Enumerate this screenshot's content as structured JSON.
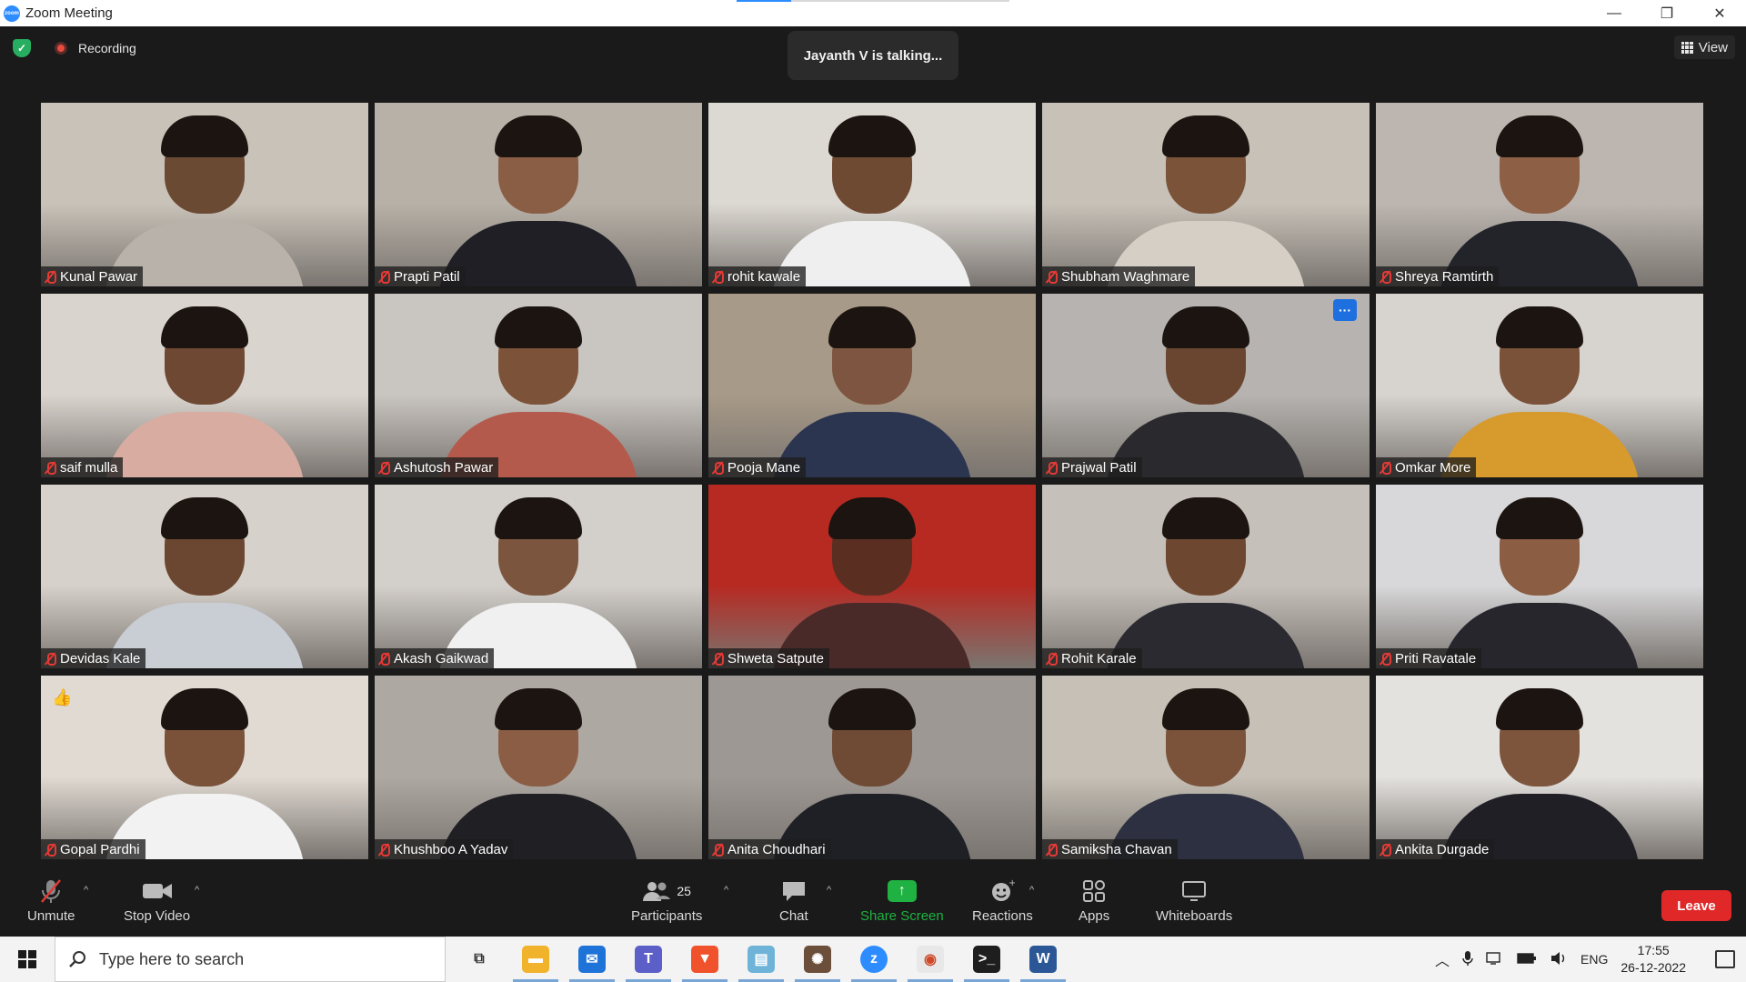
{
  "window": {
    "title": "Zoom Meeting",
    "minimize": "—",
    "restore": "❐",
    "close": "✕"
  },
  "meeting": {
    "recording_label": "Recording",
    "talking_banner": "Jayanth V is talking...",
    "view_label": "View"
  },
  "participants": [
    {
      "name": "Kunal Pawar",
      "bg": "#c9c2b9",
      "skin": "#6b4a34",
      "shirt": "#b9b2aa"
    },
    {
      "name": "Prapti Patil",
      "bg": "#b8b1a8",
      "skin": "#8a5e44",
      "shirt": "#1f1f25"
    },
    {
      "name": "rohit kawale",
      "bg": "#dcd8d2",
      "skin": "#6f4a33",
      "shirt": "#efefef"
    },
    {
      "name": "Shubham Waghmare",
      "bg": "#c7c1b8",
      "skin": "#7a5339",
      "shirt": "#d6cfc6"
    },
    {
      "name": "Shreya Ramtirth",
      "bg": "#bdb6b0",
      "skin": "#8d5f45",
      "shirt": "#23232a"
    },
    {
      "name": "saif mulla",
      "bg": "#d9d4ce",
      "skin": "#6e4833",
      "shirt": "#d8aca0"
    },
    {
      "name": "Ashutosh Pawar",
      "bg": "#c9c5c0",
      "skin": "#7c5238",
      "shirt": "#b45a4c"
    },
    {
      "name": "Pooja Mane",
      "bg": "#a89a88",
      "skin": "#7e5540",
      "shirt": "#2b3550"
    },
    {
      "name": "Prajwal Patil",
      "bg": "#b6b3b0",
      "skin": "#6a4630",
      "shirt": "#2a2a2e"
    },
    {
      "name": "Omkar More",
      "bg": "#d7d4cf",
      "skin": "#7a5139",
      "shirt": "#d79a2c"
    },
    {
      "name": "Devidas Kale",
      "bg": "#d6d1ca",
      "skin": "#6b4630",
      "shirt": "#c9cdd4"
    },
    {
      "name": "Akash Gaikwad",
      "bg": "#d3cfcb",
      "skin": "#7b553d",
      "shirt": "#f0f0f0"
    },
    {
      "name": "Shweta Satpute",
      "bg": "#b62a22",
      "skin": "#5a2f22",
      "shirt": "#4a2a28"
    },
    {
      "name": "Rohit Karale",
      "bg": "#c5c0ba",
      "skin": "#6e4731",
      "shirt": "#2a2a30"
    },
    {
      "name": "Priti Ravatale",
      "bg": "#d8d8da",
      "skin": "#8b5d43",
      "shirt": "#26262c"
    },
    {
      "name": "Gopal Pardhi",
      "bg": "#e0dad2",
      "skin": "#7a523a",
      "shirt": "#f2f2f2"
    },
    {
      "name": "Khushboo A Yadav",
      "bg": "#aea8a2",
      "skin": "#8a5d44",
      "shirt": "#1f1f24"
    },
    {
      "name": "Anita Choudhari",
      "bg": "#9d9893",
      "skin": "#6f4a35",
      "shirt": "#1f2026"
    },
    {
      "name": "Samiksha Chavan",
      "bg": "#c6c0b6",
      "skin": "#7b533b",
      "shirt": "#2c3040"
    },
    {
      "name": "Ankita Durgade",
      "bg": "#e4e2df",
      "skin": "#7d553d",
      "shirt": "#1f1f25"
    }
  ],
  "prajwal_more_label": "···",
  "gopal_reaction": "👍",
  "toolbar": {
    "unmute": "Unmute",
    "stop_video": "Stop Video",
    "participants": "Participants",
    "participants_count": "25",
    "chat": "Chat",
    "share_screen": "Share Screen",
    "reactions": "Reactions",
    "apps": "Apps",
    "whiteboards": "Whiteboards",
    "leave": "Leave",
    "caret": "^"
  },
  "taskbar": {
    "search_placeholder": "Type here to search",
    "apps": [
      {
        "icon": "task-view-icon",
        "color": "#555555",
        "glyph": "⧉"
      },
      {
        "icon": "file-explorer-icon",
        "color": "#f2b32c",
        "glyph": "▬"
      },
      {
        "icon": "mail-icon",
        "color": "#1e73d8",
        "glyph": "✉"
      },
      {
        "icon": "teams-icon",
        "color": "#5b5fc7",
        "glyph": "T"
      },
      {
        "icon": "brave-icon",
        "color": "#f0522b",
        "glyph": "▼"
      },
      {
        "icon": "notepad-icon",
        "color": "#6fb4d8",
        "glyph": "▤"
      },
      {
        "icon": "app-icon",
        "color": "#6b4f3a",
        "glyph": "✺"
      },
      {
        "icon": "zoom-icon",
        "color": "#2d8cff",
        "glyph": "z"
      },
      {
        "icon": "paint-icon",
        "color": "#e8e8e8",
        "glyph": "◉"
      },
      {
        "icon": "terminal-icon",
        "color": "#1e1e1e",
        "glyph": ">_"
      },
      {
        "icon": "word-icon",
        "color": "#2b5797",
        "glyph": "W"
      }
    ],
    "language": "ENG",
    "time": "17:55",
    "date": "26-12-2022"
  }
}
